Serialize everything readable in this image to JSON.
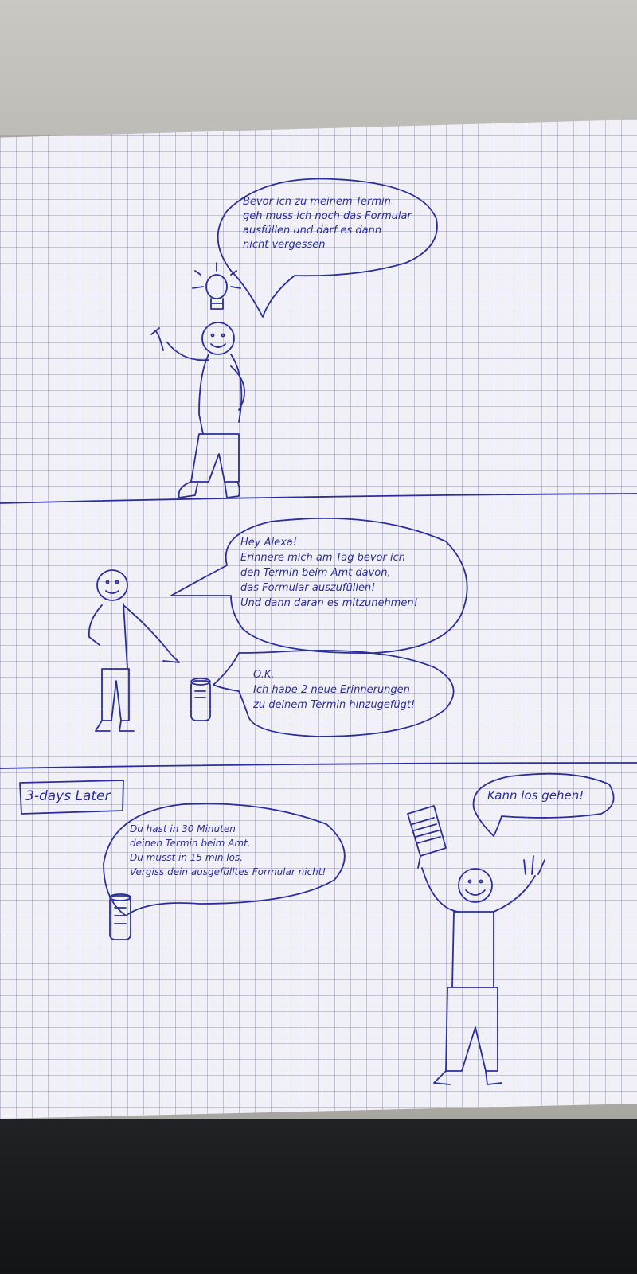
{
  "panel1": {
    "bubble_text": "Bevor ich zu meinem Termin\ngeh muss ich noch das Formular\nausfüllen und darf es dann\nnicht vergessen"
  },
  "panel2": {
    "person_bubble": "Hey Alexa!\nErinnere mich am Tag bevor ich\nden Termin beim Amt davon,\ndas Formular auszufüllen!\nUnd dann daran es mitzunehmen!",
    "speaker_bubble": "O.K.\nIch habe 2 neue Erinnerungen\nzu deinem Termin hinzugefügt!"
  },
  "panel3": {
    "caption": "3-days Later",
    "speaker_bubble": "Du hast in 30 Minuten\ndeinen Termin beim Amt.\nDu musst in 15 min los.\nVergiss dein ausgefülltes Formular nicht!",
    "person_bubble": "Kann los gehen!"
  },
  "colors": {
    "ink": "#2b2f9a",
    "paper": "#f1f0f6",
    "grid": "#8c8caf"
  }
}
